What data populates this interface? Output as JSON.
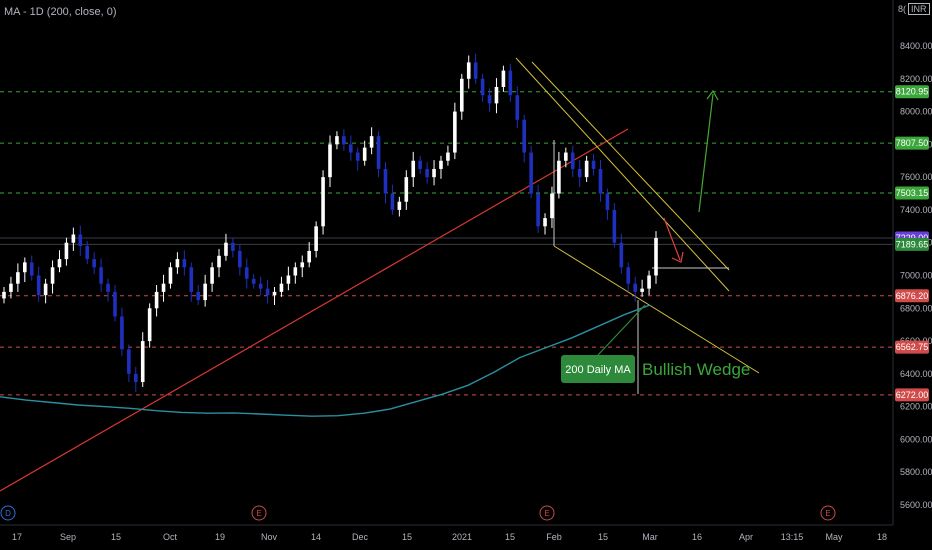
{
  "indicator_label": "MA - 1D (200, close, 0)",
  "currency": {
    "prefix": "8(",
    "code": "INR"
  },
  "colors": {
    "background": "#000000",
    "up_candle": "#ffffff",
    "down_candle": "#1f2fbf",
    "ma_line": "#2a8fa0",
    "trendline": "#d9382f",
    "wedge": "#d4c238",
    "green_level": "#3ba73b",
    "red_level": "#d24b4b",
    "arrow_up": "#44a832",
    "arrow_down": "#e0413f",
    "current_price": "#6a3fd8"
  },
  "annotations": {
    "ma_label": "200 Daily MA",
    "pattern_label": "Bullish Wedge"
  },
  "event_markers": [
    "D",
    "E",
    "E",
    "E"
  ],
  "chart_data": {
    "type": "candlestick",
    "title": "",
    "y_axis": {
      "range": [
        5500,
        8550
      ],
      "ticks": [
        5600,
        5800,
        6000,
        6200,
        6400,
        6600,
        6800,
        7000,
        7200,
        7400,
        7600,
        7800,
        8000,
        8200,
        8400
      ],
      "tick_labels": [
        "5600.00",
        "5800.00",
        "6000.00",
        "6200.00",
        "6400.00",
        "6600.00",
        "6800.00",
        "7000.00",
        "7200.00",
        "7400.00",
        "7600.00",
        "7800.00",
        "8000.00",
        "8200.00",
        "8400.00"
      ]
    },
    "x_axis": {
      "tick_labels": [
        "17",
        "Sep",
        "15",
        "Oct",
        "19",
        "Nov",
        "14",
        "Dec",
        "15",
        "2021",
        "15",
        "Feb",
        "15",
        "Mar",
        "16",
        "Apr",
        "13:15",
        "May",
        "18"
      ]
    },
    "price_levels": [
      {
        "label": "8120.95",
        "value": 8120.95,
        "kind": "resistance"
      },
      {
        "label": "7807.50",
        "value": 7807.5,
        "kind": "resistance"
      },
      {
        "label": "7503.15",
        "value": 7503.15,
        "kind": "resistance"
      },
      {
        "label": "7229.00",
        "value": 7229.0,
        "kind": "current"
      },
      {
        "label": "7189.65",
        "value": 7189.65,
        "kind": "support"
      },
      {
        "label": "6876.20",
        "value": 6876.2,
        "kind": "support"
      },
      {
        "label": "6562.75",
        "value": 6562.75,
        "kind": "support"
      },
      {
        "label": "6272.00",
        "value": 6272.0,
        "kind": "support"
      }
    ],
    "series": [
      {
        "name": "MA - 1D (200, close, 0)",
        "type": "line",
        "values": [
          6260,
          6240,
          6225,
          6210,
          6200,
          6190,
          6175,
          6165,
          6160,
          6162,
          6155,
          6148,
          6142,
          6145,
          6160,
          6185,
          6230,
          6275,
          6330,
          6410,
          6500,
          6560,
          6620,
          6690,
          6760,
          6820
        ]
      }
    ],
    "closes": [
      6900,
      6950,
      7020,
      7080,
      7000,
      6880,
      6950,
      7050,
      7100,
      7200,
      7250,
      7180,
      7100,
      7050,
      6950,
      6900,
      6750,
      6550,
      6400,
      6350,
      6600,
      6800,
      6900,
      6950,
      7050,
      7100,
      7050,
      6900,
      6850,
      6950,
      7050,
      7120,
      7200,
      7150,
      7050,
      6980,
      6950,
      6920,
      6880,
      6900,
      6950,
      7000,
      7050,
      7080,
      7150,
      7300,
      7600,
      7800,
      7850,
      7800,
      7750,
      7700,
      7780,
      7850,
      7650,
      7500,
      7400,
      7450,
      7600,
      7700,
      7650,
      7600,
      7650,
      7700,
      7750,
      8000,
      8200,
      8300,
      8200,
      8100,
      8050,
      8150,
      8250,
      8100,
      7950,
      7750,
      7500,
      7300,
      7350,
      7500,
      7700,
      7750,
      7650,
      7600,
      7700,
      7650,
      7500,
      7400,
      7200,
      7050,
      6950,
      6900,
      6920,
      7000,
      7229
    ]
  }
}
